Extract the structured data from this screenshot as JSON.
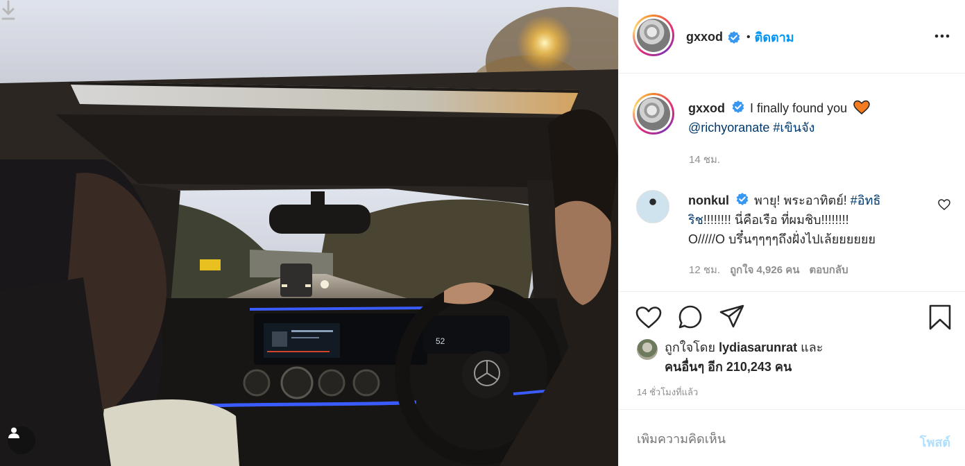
{
  "post": {
    "author": "gxxod",
    "follow_label": "ติดตาม",
    "dot": "•"
  },
  "caption": {
    "username": "gxxod",
    "text": "I finally found you",
    "mention": "@richyoranate",
    "hashtag": "#เขินจัง",
    "time": "14 ชม."
  },
  "comment": {
    "username": "nonkul",
    "text_part1": "พายุ! พระอาทิตย์!",
    "hashtag": "#อิทธิ",
    "line2_start": "ริช",
    "line2_rest": "!!!!!!!! นี่คือเรือ ที่ผมชิบ!!!!!!!!",
    "line3": "O/////O บรึ๋นๆๆๆๆถึงฝั่งไปเล้ยยยยยย",
    "time": "12 ชม.",
    "likes": "ถูกใจ 4,926 คน",
    "reply": "ตอบกลับ"
  },
  "likes": {
    "prefix": "ถูกใจโดย",
    "user": "lydiasarunrat",
    "and": "และ",
    "others": "คนอื่นๆ อีก 210,243 คน"
  },
  "time_ago": "14 ชั่วโมงที่แล้ว",
  "add_comment": {
    "placeholder": "เพิ่มความคิดเห็น",
    "post_label": "โพสต์"
  },
  "colors": {
    "accent": "#0095f6",
    "post_disabled": "#b2dffc",
    "muted": "#8e8e8e"
  }
}
